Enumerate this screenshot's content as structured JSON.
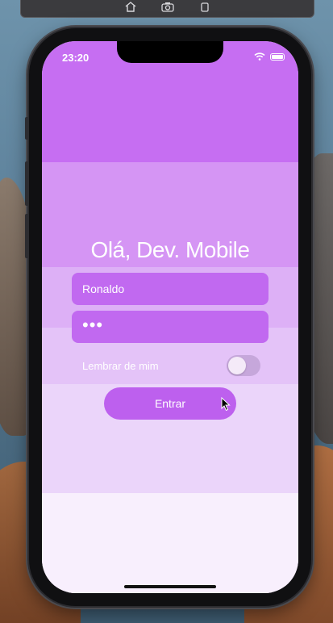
{
  "toolbar": {
    "buttons": [
      {
        "name": "home-icon"
      },
      {
        "name": "camera-icon"
      },
      {
        "name": "rotate-icon"
      }
    ]
  },
  "status_bar": {
    "time": "23:20",
    "icons": [
      "wifi-icon",
      "battery-icon"
    ]
  },
  "login": {
    "title": "Olá, Dev. Mobile",
    "username_value": "Ronaldo",
    "password_masked": "•••",
    "remember_label": "Lembrar de mim",
    "remember_on": false,
    "submit_label": "Entrar"
  },
  "colors": {
    "primary": "#c169f0",
    "button": "#bd60ee",
    "background_bands": [
      "#c66ef2",
      "#d595f4",
      "#ddb0f6",
      "#e4c3f8",
      "#ebd5fa",
      "#f8effd"
    ]
  }
}
